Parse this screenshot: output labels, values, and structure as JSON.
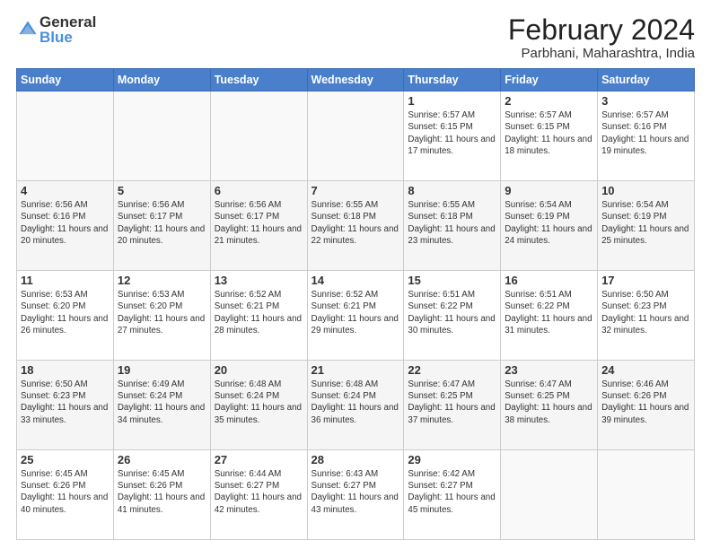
{
  "logo": {
    "general": "General",
    "blue": "Blue"
  },
  "title": "February 2024",
  "subtitle": "Parbhani, Maharashtra, India",
  "days_of_week": [
    "Sunday",
    "Monday",
    "Tuesday",
    "Wednesday",
    "Thursday",
    "Friday",
    "Saturday"
  ],
  "weeks": [
    [
      {
        "day": "",
        "info": ""
      },
      {
        "day": "",
        "info": ""
      },
      {
        "day": "",
        "info": ""
      },
      {
        "day": "",
        "info": ""
      },
      {
        "day": "1",
        "info": "Sunrise: 6:57 AM\nSunset: 6:15 PM\nDaylight: 11 hours and 17 minutes."
      },
      {
        "day": "2",
        "info": "Sunrise: 6:57 AM\nSunset: 6:15 PM\nDaylight: 11 hours and 18 minutes."
      },
      {
        "day": "3",
        "info": "Sunrise: 6:57 AM\nSunset: 6:16 PM\nDaylight: 11 hours and 19 minutes."
      }
    ],
    [
      {
        "day": "4",
        "info": "Sunrise: 6:56 AM\nSunset: 6:16 PM\nDaylight: 11 hours and 20 minutes."
      },
      {
        "day": "5",
        "info": "Sunrise: 6:56 AM\nSunset: 6:17 PM\nDaylight: 11 hours and 20 minutes."
      },
      {
        "day": "6",
        "info": "Sunrise: 6:56 AM\nSunset: 6:17 PM\nDaylight: 11 hours and 21 minutes."
      },
      {
        "day": "7",
        "info": "Sunrise: 6:55 AM\nSunset: 6:18 PM\nDaylight: 11 hours and 22 minutes."
      },
      {
        "day": "8",
        "info": "Sunrise: 6:55 AM\nSunset: 6:18 PM\nDaylight: 11 hours and 23 minutes."
      },
      {
        "day": "9",
        "info": "Sunrise: 6:54 AM\nSunset: 6:19 PM\nDaylight: 11 hours and 24 minutes."
      },
      {
        "day": "10",
        "info": "Sunrise: 6:54 AM\nSunset: 6:19 PM\nDaylight: 11 hours and 25 minutes."
      }
    ],
    [
      {
        "day": "11",
        "info": "Sunrise: 6:53 AM\nSunset: 6:20 PM\nDaylight: 11 hours and 26 minutes."
      },
      {
        "day": "12",
        "info": "Sunrise: 6:53 AM\nSunset: 6:20 PM\nDaylight: 11 hours and 27 minutes."
      },
      {
        "day": "13",
        "info": "Sunrise: 6:52 AM\nSunset: 6:21 PM\nDaylight: 11 hours and 28 minutes."
      },
      {
        "day": "14",
        "info": "Sunrise: 6:52 AM\nSunset: 6:21 PM\nDaylight: 11 hours and 29 minutes."
      },
      {
        "day": "15",
        "info": "Sunrise: 6:51 AM\nSunset: 6:22 PM\nDaylight: 11 hours and 30 minutes."
      },
      {
        "day": "16",
        "info": "Sunrise: 6:51 AM\nSunset: 6:22 PM\nDaylight: 11 hours and 31 minutes."
      },
      {
        "day": "17",
        "info": "Sunrise: 6:50 AM\nSunset: 6:23 PM\nDaylight: 11 hours and 32 minutes."
      }
    ],
    [
      {
        "day": "18",
        "info": "Sunrise: 6:50 AM\nSunset: 6:23 PM\nDaylight: 11 hours and 33 minutes."
      },
      {
        "day": "19",
        "info": "Sunrise: 6:49 AM\nSunset: 6:24 PM\nDaylight: 11 hours and 34 minutes."
      },
      {
        "day": "20",
        "info": "Sunrise: 6:48 AM\nSunset: 6:24 PM\nDaylight: 11 hours and 35 minutes."
      },
      {
        "day": "21",
        "info": "Sunrise: 6:48 AM\nSunset: 6:24 PM\nDaylight: 11 hours and 36 minutes."
      },
      {
        "day": "22",
        "info": "Sunrise: 6:47 AM\nSunset: 6:25 PM\nDaylight: 11 hours and 37 minutes."
      },
      {
        "day": "23",
        "info": "Sunrise: 6:47 AM\nSunset: 6:25 PM\nDaylight: 11 hours and 38 minutes."
      },
      {
        "day": "24",
        "info": "Sunrise: 6:46 AM\nSunset: 6:26 PM\nDaylight: 11 hours and 39 minutes."
      }
    ],
    [
      {
        "day": "25",
        "info": "Sunrise: 6:45 AM\nSunset: 6:26 PM\nDaylight: 11 hours and 40 minutes."
      },
      {
        "day": "26",
        "info": "Sunrise: 6:45 AM\nSunset: 6:26 PM\nDaylight: 11 hours and 41 minutes."
      },
      {
        "day": "27",
        "info": "Sunrise: 6:44 AM\nSunset: 6:27 PM\nDaylight: 11 hours and 42 minutes."
      },
      {
        "day": "28",
        "info": "Sunrise: 6:43 AM\nSunset: 6:27 PM\nDaylight: 11 hours and 43 minutes."
      },
      {
        "day": "29",
        "info": "Sunrise: 6:42 AM\nSunset: 6:27 PM\nDaylight: 11 hours and 45 minutes."
      },
      {
        "day": "",
        "info": ""
      },
      {
        "day": "",
        "info": ""
      }
    ]
  ]
}
